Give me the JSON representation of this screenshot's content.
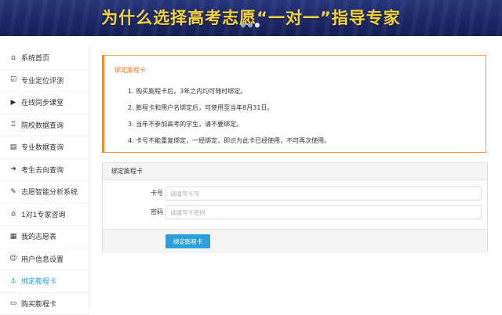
{
  "banner": {
    "title": "为什么选择高考志愿“一对一”指导专家"
  },
  "sidebar": {
    "items": [
      {
        "label": "系统首页",
        "icon": "home-icon",
        "glyph": "⌂",
        "active": false
      },
      {
        "label": "专业定位评测",
        "icon": "checkbox-edit-icon",
        "glyph": "☑",
        "active": false
      },
      {
        "label": "在线同步课堂",
        "icon": "video-icon",
        "glyph": "▶",
        "active": false
      },
      {
        "label": "院校数据查询",
        "icon": "institution-icon",
        "glyph": "♖",
        "active": false
      },
      {
        "label": "专业数据查询",
        "icon": "book-icon",
        "glyph": "▤",
        "active": false
      },
      {
        "label": "考生去向查询",
        "icon": "arrow-right-icon",
        "glyph": "➔",
        "active": false
      },
      {
        "label": "志愿智能分析系统",
        "icon": "edit-icon",
        "glyph": "✎",
        "active": false
      },
      {
        "label": "1对1专家咨询",
        "icon": "graduation-cap-icon",
        "glyph": "⌂",
        "active": false
      },
      {
        "label": "我的志愿表",
        "icon": "table-icon",
        "glyph": "▦",
        "active": false
      },
      {
        "label": "用户信息设置",
        "icon": "user-icon",
        "glyph": "☺",
        "active": false
      },
      {
        "label": "绑定膨程卡",
        "icon": "anchor-icon",
        "glyph": "⚓",
        "active": true
      },
      {
        "label": "购买膨程卡",
        "icon": "credit-card-icon",
        "glyph": "▭",
        "active": false
      }
    ]
  },
  "notice": {
    "title": "绑定膨程卡",
    "items": [
      "1. 购买膨程卡后，3年之内均可随时绑定。",
      "2. 膨程卡和用户名绑定后，可使用至当年8月31日。",
      "3. 当年不参加高考的学生，请不要绑定。",
      "4. 卡号不能重复绑定，一经绑定，即识为此卡已经使用，不可再次使用。"
    ]
  },
  "form": {
    "heading": "绑定膨程卡",
    "card_label": "卡号",
    "card_placeholder": "请填写卡号",
    "password_label": "密码",
    "password_placeholder": "请填写卡密码",
    "submit_label": "绑定膨程卡"
  },
  "colors": {
    "banner_bg": "#1b2765",
    "banner_text": "#f5d33a",
    "accent": "#2aa0dc",
    "notice_border": "#f08c2a"
  }
}
